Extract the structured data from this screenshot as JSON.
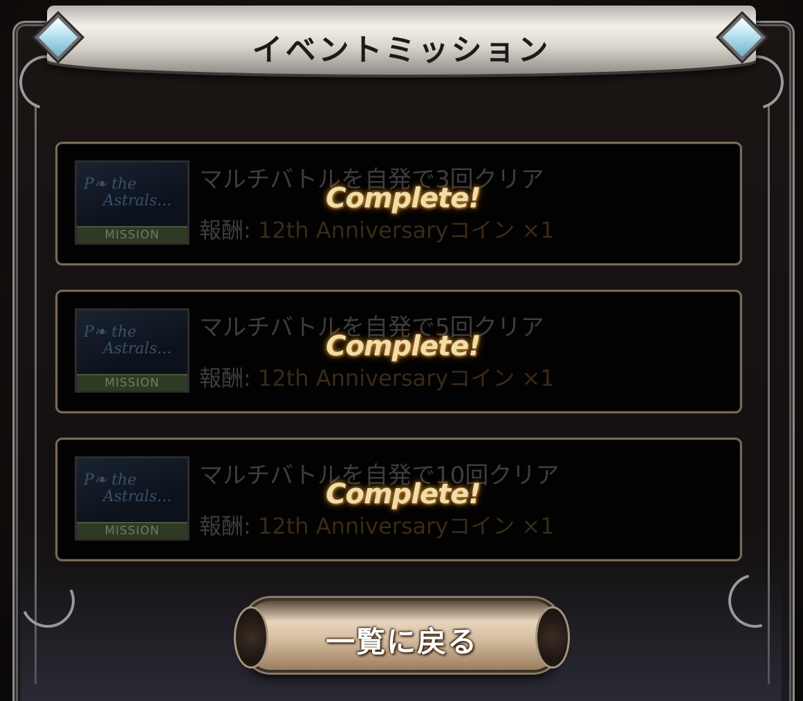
{
  "header": {
    "title": "イベントミッション"
  },
  "missions": [
    {
      "thumbnail_script_1": "P❧ the",
      "thumbnail_script_2": "Astrals...",
      "thumbnail_tag": "MISSION",
      "name": "マルチバトルを自発で3回クリア",
      "reward_label": "報酬:",
      "reward_value": "12th Anniversaryコイン ×1",
      "status": "Complete!"
    },
    {
      "thumbnail_script_1": "P❧ the",
      "thumbnail_script_2": "Astrals...",
      "thumbnail_tag": "MISSION",
      "name": "マルチバトルを自発で5回クリア",
      "reward_label": "報酬:",
      "reward_value": "12th Anniversaryコイン ×1",
      "status": "Complete!"
    },
    {
      "thumbnail_script_1": "P❧ the",
      "thumbnail_script_2": "Astrals...",
      "thumbnail_tag": "MISSION",
      "name": "マルチバトルを自発で10回クリア",
      "reward_label": "報酬:",
      "reward_value": "12th Anniversaryコイン ×1",
      "status": "Complete!"
    }
  ],
  "footer": {
    "back_label": "一覧に戻る"
  },
  "colors": {
    "card_border": "#7a6a55",
    "complete_text": "#f1ddaa",
    "dimmed_text": "#3e3d3d",
    "reward_text": "#3a2a18"
  }
}
